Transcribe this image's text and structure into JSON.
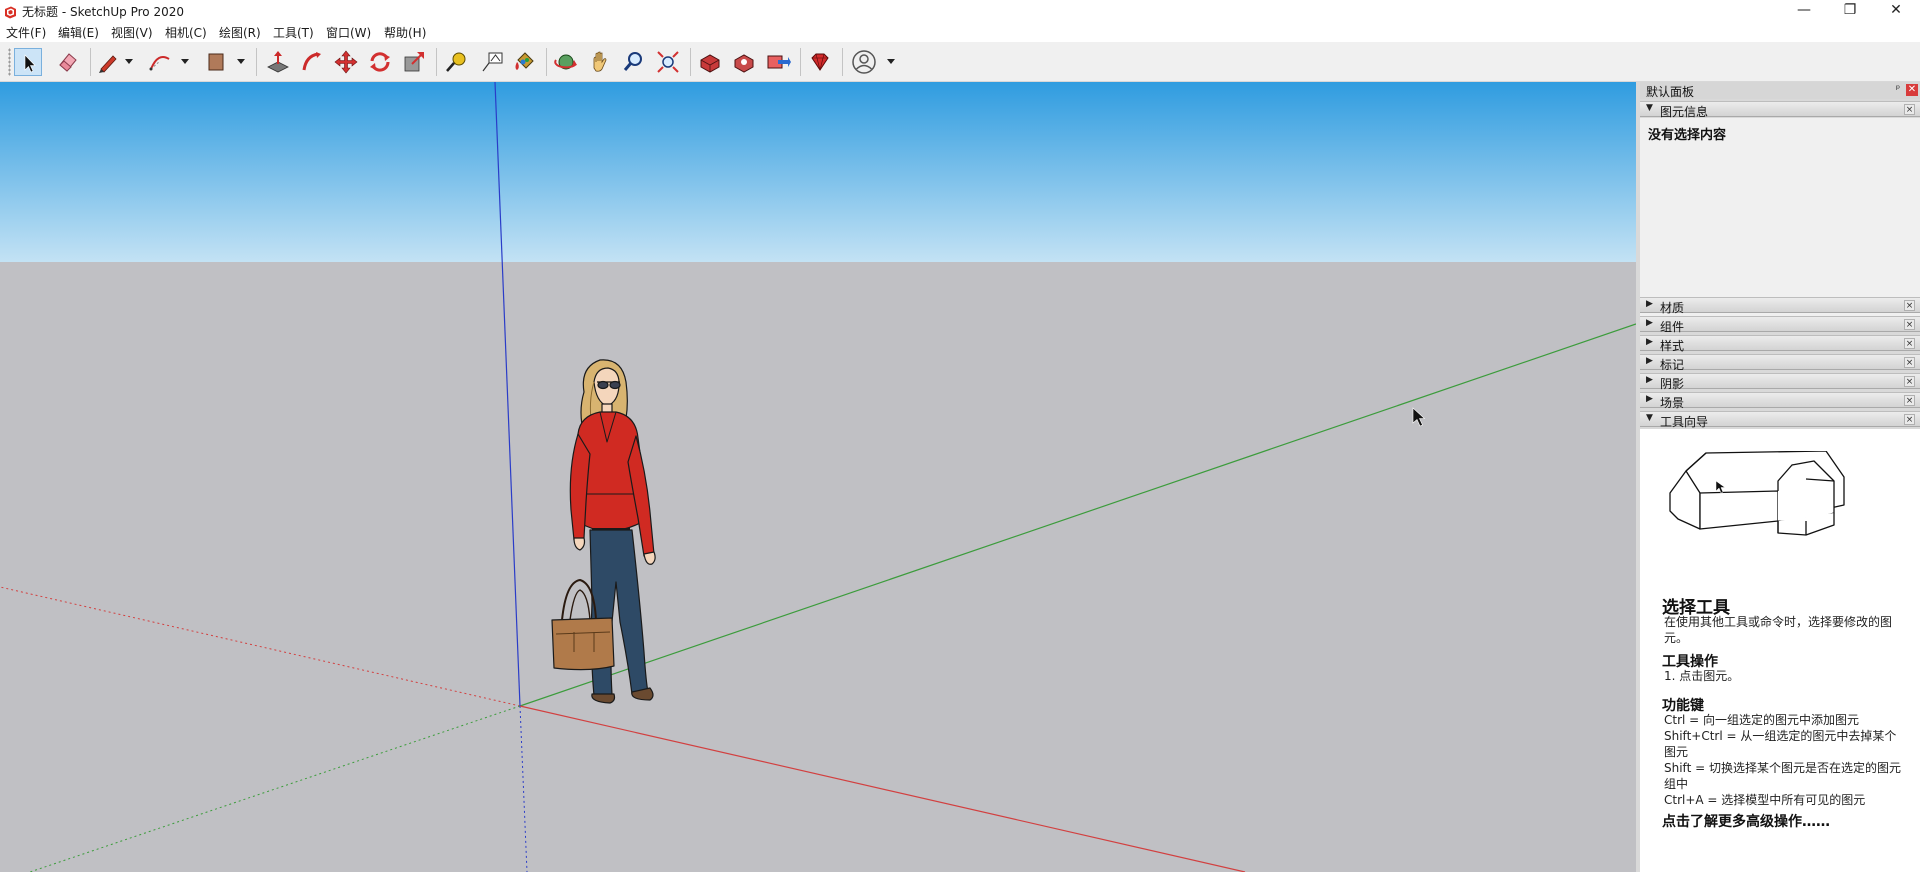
{
  "window": {
    "title": "无标题 - SketchUp Pro 2020",
    "min_glyph": "—",
    "max_glyph": "❐",
    "close_glyph": "✕"
  },
  "menu": [
    "文件(F)",
    "编辑(E)",
    "视图(V)",
    "相机(C)",
    "绘图(R)",
    "工具(T)",
    "窗口(W)",
    "帮助(H)"
  ],
  "toolbar": {
    "tools": [
      "select",
      "eraser",
      "line",
      "arc",
      "rectangle",
      "push-pull",
      "follow-me",
      "move",
      "rotate",
      "scale",
      "tape-measure",
      "text",
      "paint-bucket",
      "orbit",
      "pan",
      "zoom",
      "zoom-extents",
      "3d-warehouse",
      "extension-warehouse",
      "layout",
      "extension-manager",
      "account"
    ],
    "active_tool": "select"
  },
  "colors": {
    "sky_top": "#2f9ce0",
    "sky_bottom": "#c3e2f4",
    "ground": "#c0c0c4",
    "axis_red": "#d24040",
    "axis_green": "#3c9c3c",
    "axis_blue": "#2a3cc8",
    "tray_bg": "#d9d9d9"
  },
  "tray": {
    "title": "默认面板",
    "pin_glyph": "ᵖ",
    "close_glyph": "✕",
    "entity_info": {
      "label": "图元信息",
      "expanded": true,
      "content": "没有选择内容"
    },
    "collapsed_panels": [
      "材质",
      "组件",
      "样式",
      "标记",
      "阴影",
      "场景"
    ],
    "instructor": {
      "label": "工具向导",
      "expanded": true,
      "tool_name": "选择工具",
      "description": "在使用其他工具或命令时，选择要修改的图元。",
      "ops_heading": "工具操作",
      "ops": "1. 点击图元。",
      "keys_heading": "功能键",
      "keys": [
        "Ctrl = 向一组选定的图元中添加图元",
        "Shift+Ctrl = 从一组选定的图元中去掉某个图元",
        "Shift = 切换选择某个图元是否在选定的图元组中",
        "Ctrl+A = 选择模型中所有可见的图元"
      ],
      "more": "点击了解更多高级操作……"
    }
  },
  "glyphs": {
    "expanded": "▼",
    "collapsed": "▶",
    "panel_close": "×"
  }
}
